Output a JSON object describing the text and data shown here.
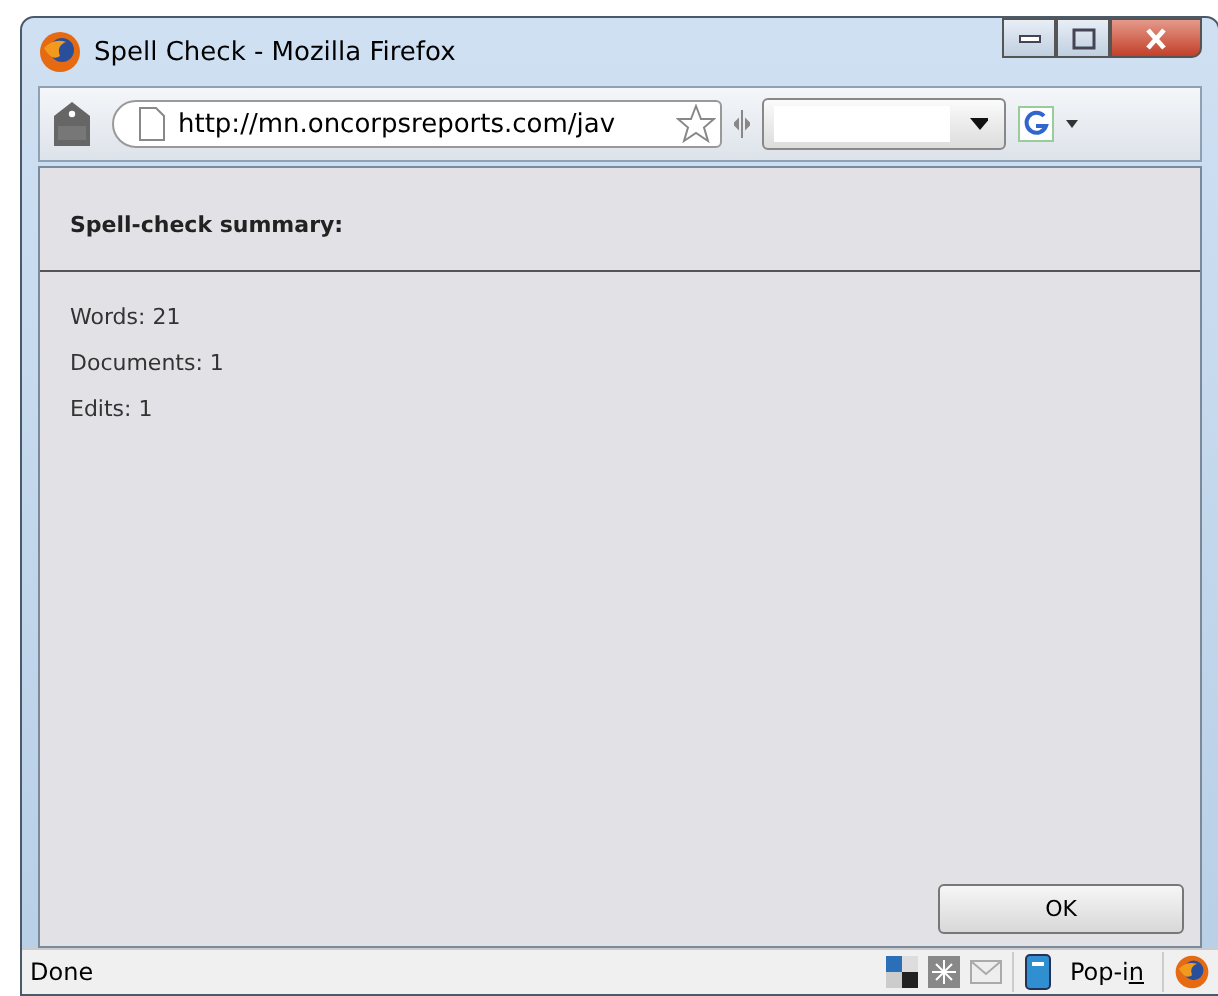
{
  "window": {
    "title": "Spell Check - Mozilla Firefox"
  },
  "toolbar": {
    "url": "http://mn.oncorpsreports.com/jav"
  },
  "summary": {
    "heading": "Spell-check summary:",
    "lines": [
      "Words: 21",
      "Documents: 1",
      "Edits: 1"
    ]
  },
  "buttons": [
    "OK"
  ],
  "status_bar": {
    "text": "Done",
    "popin": {
      "label": "Pop-i",
      "access_key": "n"
    }
  }
}
